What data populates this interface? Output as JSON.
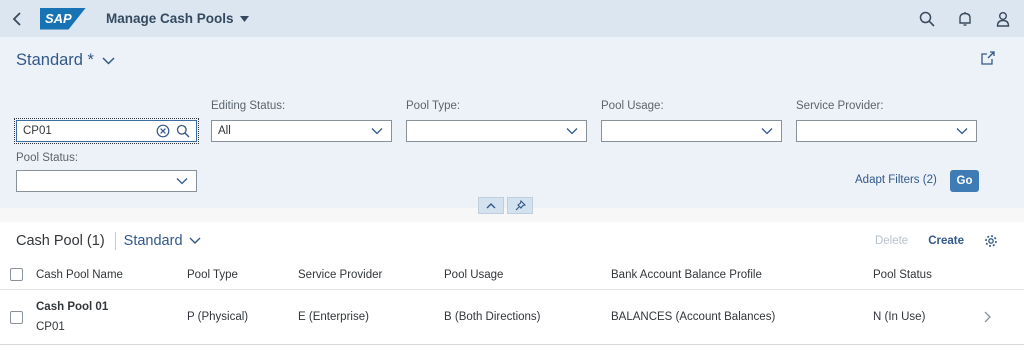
{
  "shell": {
    "logo_text": "SAP",
    "app_title": "Manage Cash Pools",
    "icons": [
      "back-icon",
      "search-icon",
      "bell-icon",
      "user-icon"
    ]
  },
  "header": {
    "variant_name": "Standard *",
    "filters": {
      "search_value": "CP01",
      "editing_status_label": "Editing Status:",
      "editing_status_value": "All",
      "pool_type_label": "Pool Type:",
      "pool_type_value": "",
      "pool_usage_label": "Pool Usage:",
      "pool_usage_value": "",
      "service_provider_label": "Service Provider:",
      "service_provider_value": "",
      "pool_status_label": "Pool Status:",
      "pool_status_value": ""
    },
    "adapt_filters": "Adapt Filters (2)",
    "go_label": "Go"
  },
  "table": {
    "title": "Cash Pool (1)",
    "variant": "Standard",
    "delete_label": "Delete",
    "create_label": "Create",
    "columns": [
      "Cash Pool Name",
      "Pool Type",
      "Service Provider",
      "Pool Usage",
      "Bank Account Balance Profile",
      "Pool Status"
    ],
    "rows": [
      {
        "name": "Cash Pool 01",
        "id": "CP01",
        "pool_type": "P (Physical)",
        "service_provider": "E (Enterprise)",
        "pool_usage": "B (Both Directions)",
        "balance_profile": "BALANCES (Account Balances)",
        "pool_status": "N (In Use)"
      }
    ]
  },
  "colors": {
    "shell_bg": "#dbe6f1",
    "header_bg": "#edf2f8",
    "link": "#32588a",
    "go_button": "#3f7bb4"
  }
}
